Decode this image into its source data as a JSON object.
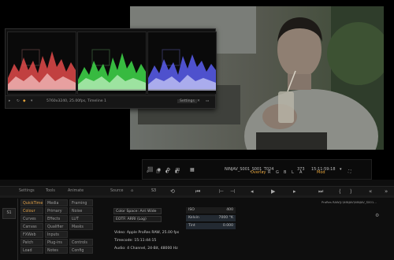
{
  "scopes": {
    "status_text": "5760x3240, 25.00fps, Timeline 1",
    "settings_label": "Settings",
    "colors": {
      "red": "#e24a4a",
      "green": "#3fd94a",
      "blue": "#5a5ef0"
    }
  },
  "transport": {
    "clip_name": "NINJAV_S001_S001_T024",
    "frame_count": "373",
    "timecode": "15:11:59:18",
    "overlay_label": "Overlay",
    "channels": [
      "R",
      "G",
      "B",
      "L",
      "A"
    ],
    "mode_label": "Mod",
    "accent": "#e8a53b"
  },
  "panel": {
    "tabs": [
      "Settings",
      "Tools",
      "Animate"
    ],
    "source_label": "Source",
    "source_num": "S3",
    "left_badge": "S1",
    "profile_text": "ProRes RAW(J:\\NINJAV\\NINJAV_S001...",
    "codec_buttons": [
      [
        "QuickTime",
        "Media",
        "Framing"
      ],
      [
        "Colour",
        "Primary",
        "Noise"
      ],
      [
        "Curves",
        "Effects",
        "LUT"
      ],
      [
        "Canvas",
        "Qualifier",
        "Masks"
      ],
      [
        "FXWeb",
        "Inputs",
        ""
      ],
      [
        "Patch",
        "Plug-ins",
        "Controls"
      ],
      [
        "Load",
        "Notes",
        "Config"
      ]
    ],
    "colour_space": "Color Space: Arri Wide",
    "gamma": "EOTF: ARRI (Log)",
    "video_info": "Video: Apple ProRes RAW, 25.00 fps",
    "timecode_info": "Timecode: 15:11:44:15",
    "audio_info": "Audio: 4 Channel, 24-Bit, 48000 Hz",
    "iso_label": "ISO",
    "iso_value": "400",
    "kelvin_label": "Kelvin",
    "kelvin_value": "7000 °K",
    "tint_label": "Tint",
    "tint_value": "0.000"
  }
}
